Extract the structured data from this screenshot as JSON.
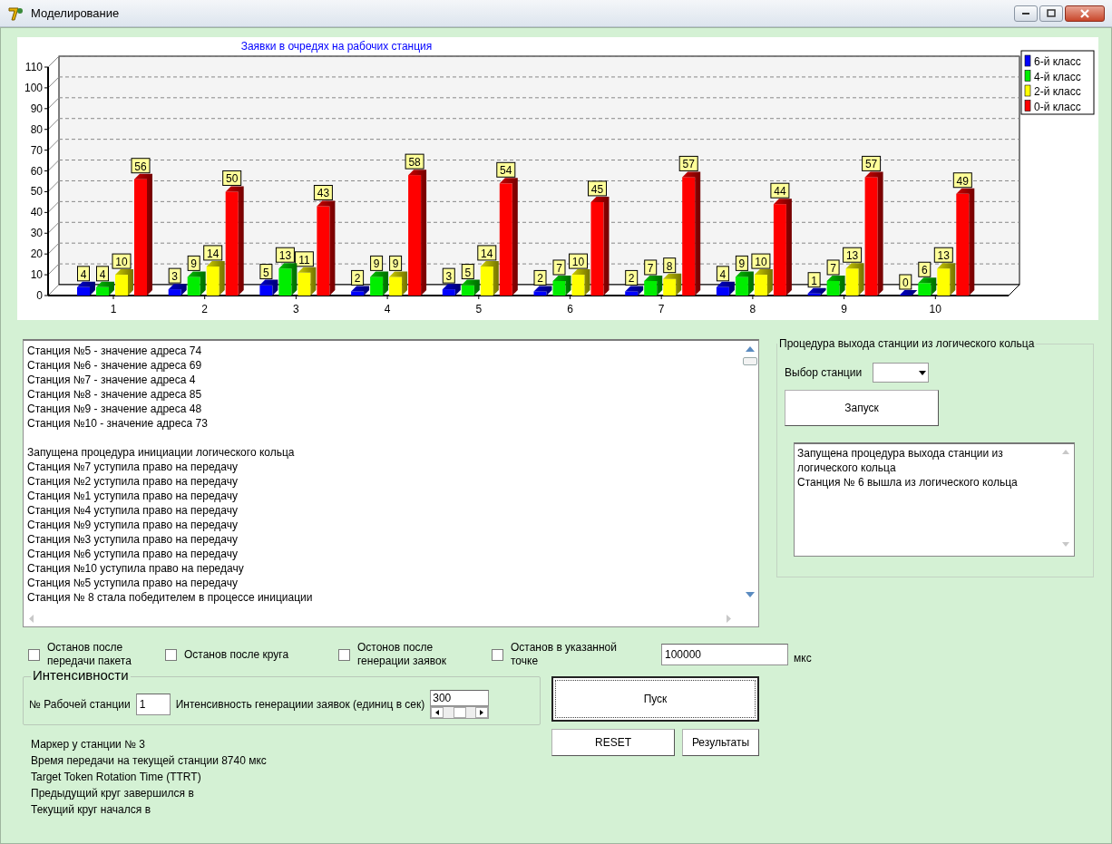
{
  "window": {
    "title": "Моделирование"
  },
  "chart": {
    "chart_data": {
      "type": "bar",
      "title": "Заявки в очредях на рабочих станция",
      "categories": [
        "1",
        "2",
        "3",
        "4",
        "5",
        "6",
        "7",
        "8",
        "9",
        "10"
      ],
      "series": [
        {
          "name": "6-й класс",
          "color": "#0000ff",
          "values": [
            4,
            3,
            5,
            2,
            3,
            2,
            2,
            4,
            1,
            0
          ]
        },
        {
          "name": "4-й класс",
          "color": "#00ee00",
          "values": [
            4,
            9,
            13,
            9,
            5,
            7,
            7,
            9,
            7,
            6
          ]
        },
        {
          "name": "2-й класс",
          "color": "#ffff00",
          "values": [
            10,
            14,
            11,
            9,
            14,
            10,
            8,
            10,
            13,
            13
          ]
        },
        {
          "name": "0-й класс",
          "color": "#ff0000",
          "values": [
            56,
            50,
            43,
            58,
            54,
            45,
            57,
            44,
            57,
            49
          ]
        }
      ],
      "legend": true,
      "ylim": [
        0,
        110
      ],
      "yticks": [
        0,
        10,
        20,
        30,
        40,
        50,
        60,
        70,
        80,
        90,
        100,
        110
      ],
      "data_labels": true
    }
  },
  "log": {
    "blocks": [
      [
        "Станция №5 - значение адреса 74",
        "Станция №6 - значение адреса 69",
        "Станция №7 - значение адреса 4",
        "Станция №8 - значение адреса 85",
        "Станция №9 - значение адреса 48",
        "Станция №10 - значение адреса 73"
      ],
      [
        "Запущена процедура инициации логического кольца",
        "Станция №7 уступила право на передачу",
        "Станция №2 уступила право на передачу",
        "Станция №1 уступила право на передачу",
        "Станция №4 уступила право на передачу",
        "Станция №9 уступила право на передачу",
        "Станция №3 уступила право на передачу",
        "Станция №6 уступила право на передачу",
        "Станция №10 уступила право на передачу",
        "Станция №5 уступила право на передачу",
        "Станция № 8 стала победителем в процессе инициации"
      ]
    ]
  },
  "stop_options": [
    {
      "label": "Останов после передачи пакета",
      "checked": false
    },
    {
      "label": "Останов после круга",
      "checked": false
    },
    {
      "label": "Остонов после генерации заявок",
      "checked": false
    },
    {
      "label": "Останов в указанной точке",
      "checked": false
    }
  ],
  "stop_time": {
    "value": "100000",
    "unit": "мкс"
  },
  "intensities": {
    "title": "Интенсивности",
    "station_label": "№ Рабочей станции",
    "station_value": "1",
    "rate_label": "Интенсивность генерациии заявок (единиц в сек)",
    "rate_value": "300"
  },
  "buttons": {
    "start": "Пуск",
    "reset": "RESET",
    "results": "Результаты"
  },
  "status_lines": [
    "Маркер у станции № 3",
    "Время передачи на текущей станции 8740 мкс",
    "Target Token Rotation Time (TTRT)",
    "Предыдущий круг завершился в",
    "Текущий круг начался в"
  ],
  "exit_procedure": {
    "title": "Процедура выхода станции из логического кольца",
    "station_label": "Выбор станции",
    "run_button": "Запуск",
    "log": [
      "Запущена процедура выхода станции из логического кольца",
      "Станция № 6 вышла из логического кольца"
    ]
  }
}
